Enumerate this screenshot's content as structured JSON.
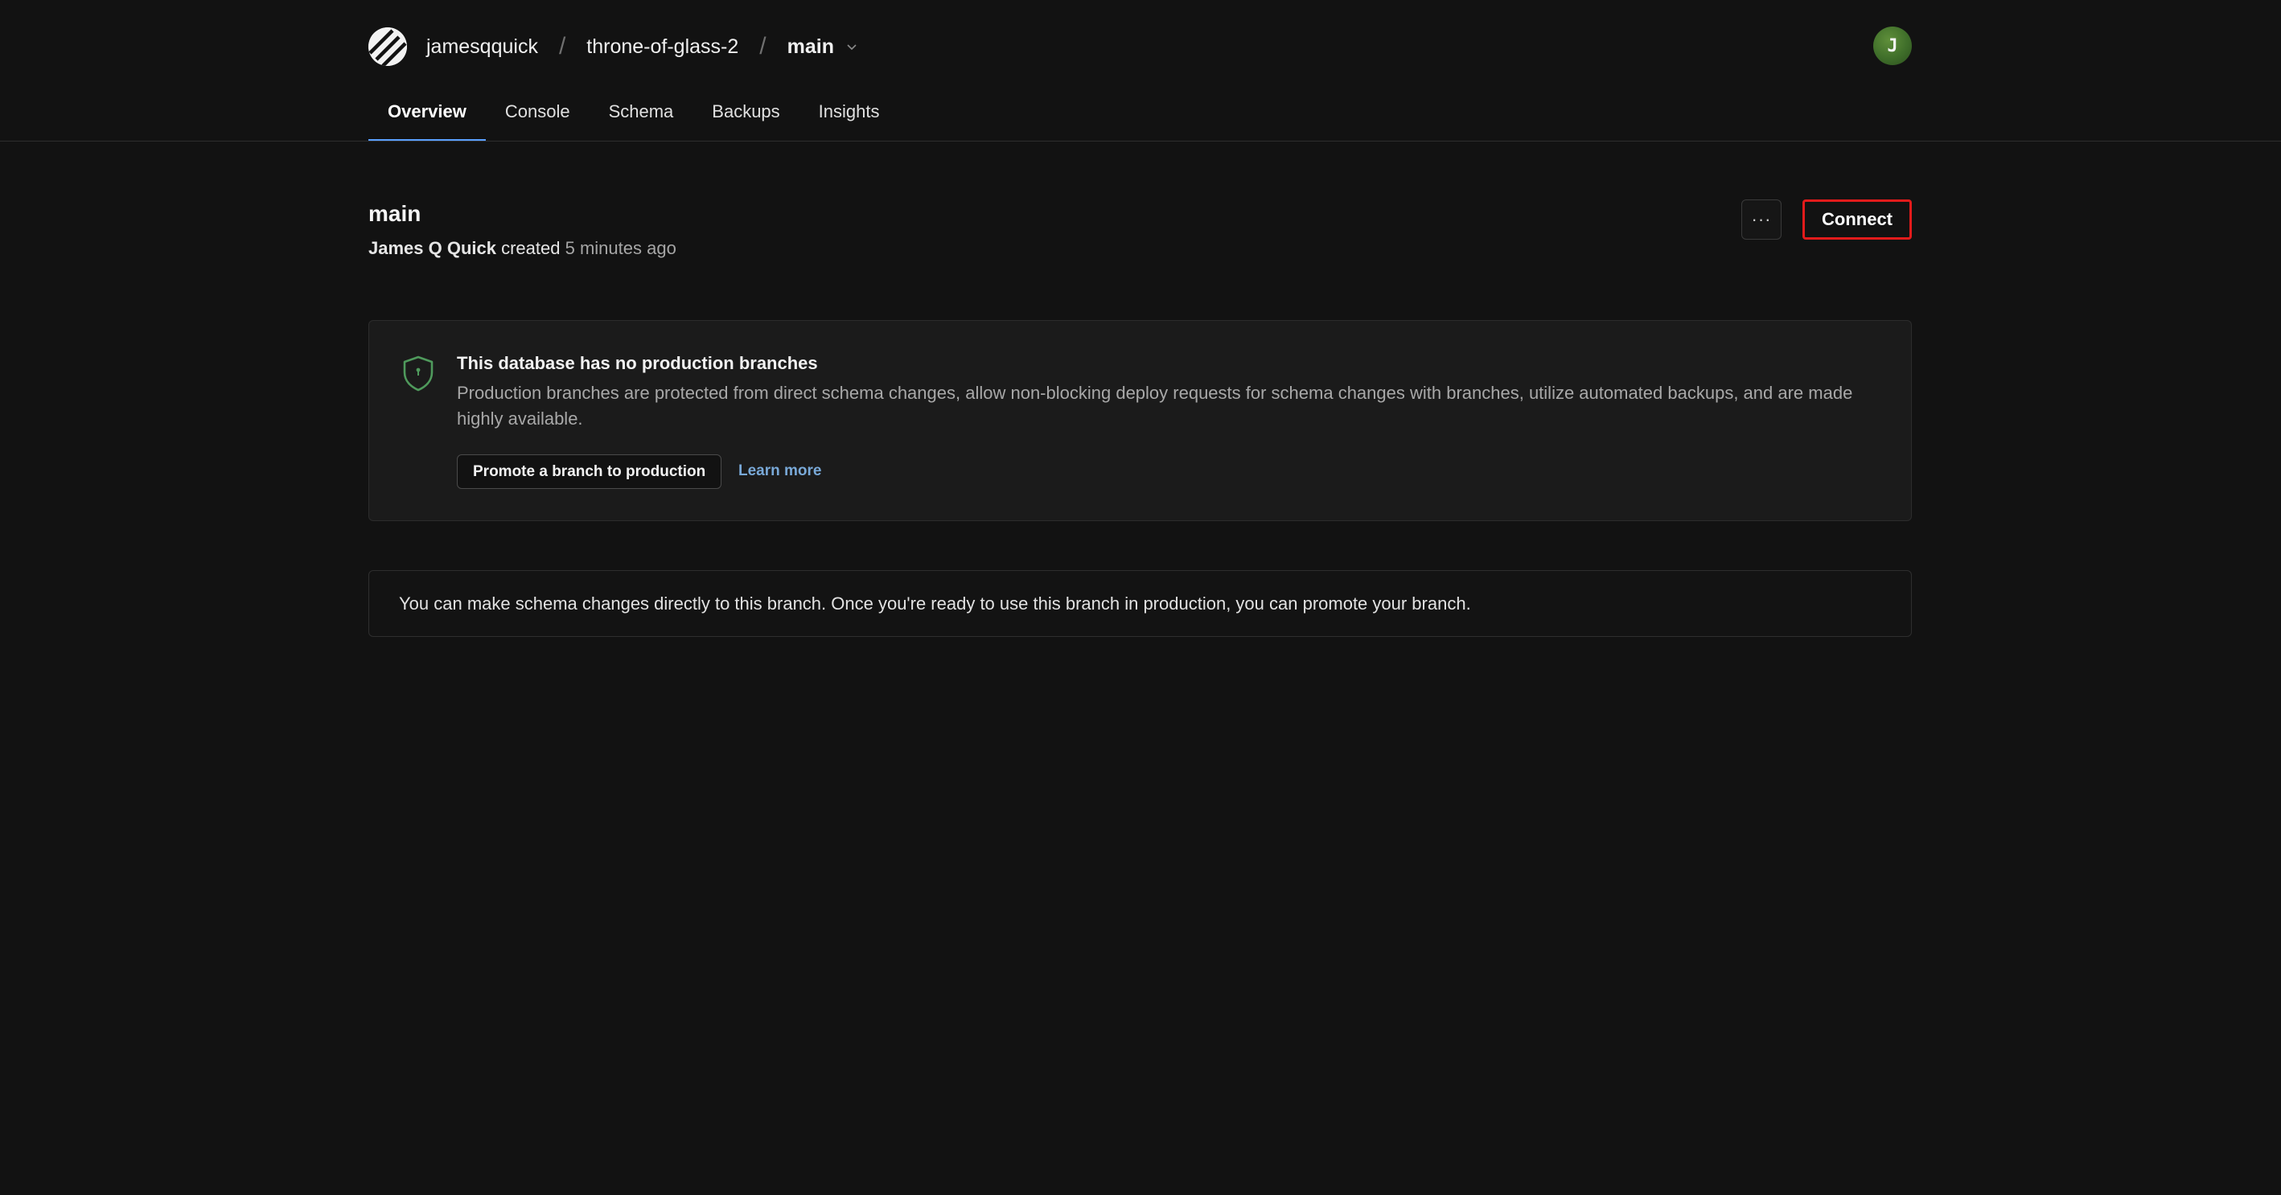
{
  "header": {
    "org": "jamesqquick",
    "database": "throne-of-glass-2",
    "branch": "main",
    "avatar_initial": "J",
    "avatar_color": "#3f6e2a"
  },
  "tabs": [
    {
      "label": "Overview",
      "active": true
    },
    {
      "label": "Console",
      "active": false
    },
    {
      "label": "Schema",
      "active": false
    },
    {
      "label": "Backups",
      "active": false
    },
    {
      "label": "Insights",
      "active": false
    }
  ],
  "branch_info": {
    "title": "main",
    "author": "James Q Quick",
    "created_label": "created",
    "time_ago": "5 minutes ago"
  },
  "actions": {
    "more_label": "···",
    "connect_label": "Connect"
  },
  "notice": {
    "icon": "shield-icon",
    "title": "This database has no production branches",
    "body": "Production branches are protected from direct schema changes, allow non-blocking deploy requests for schema changes with branches, utilize automated backups, and are made highly available.",
    "promote_label": "Promote a branch to production",
    "learn_more_label": "Learn more"
  },
  "info": {
    "message": "You can make schema changes directly to this branch. Once you're ready to use this branch in production, you can promote your branch."
  },
  "colors": {
    "background": "#121212",
    "accent_tab": "#5aa0ff",
    "connect_highlight": "#e21b1b",
    "link": "#79a9d8",
    "shield": "#4f9a5c"
  }
}
